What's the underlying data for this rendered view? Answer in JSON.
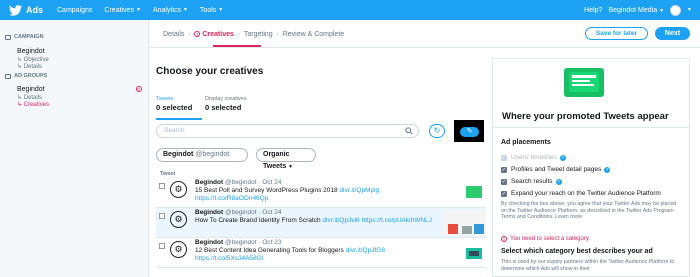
{
  "topbar": {
    "app": "Ads",
    "menus": [
      "Campaigns",
      "Creatives",
      "Analytics",
      "Tools"
    ],
    "help": "Help?",
    "account": "Begindot Media"
  },
  "sidebar": {
    "campaign_header": "CAMPAIGN",
    "campaign_name": "Begindot",
    "campaign_items": [
      "Objective",
      "Details"
    ],
    "adgroups_header": "AD GROUPS",
    "adgroup_name": "Begindot",
    "adgroup_items": [
      "Details",
      "Creatives"
    ]
  },
  "steps": [
    "Details",
    "Creatives",
    "Targeting",
    "Review & Complete"
  ],
  "actions": {
    "save": "Save for later",
    "next": "Next"
  },
  "page_title": "Choose your creatives",
  "tabs": [
    {
      "label": "Tweets",
      "count": "0 selected"
    },
    {
      "label": "Display creatives",
      "count": "0 selected"
    }
  ],
  "search_placeholder": "Search",
  "filters": {
    "account": "Begindot",
    "handle": "@begindot",
    "type": "Organic Tweets"
  },
  "column_header": "Tweet",
  "tweets": [
    {
      "name": "Begindot",
      "handle": "@begindot",
      "date": "Oct 24",
      "text": "15 Best Poll and Survey WordPress Plugins 2018",
      "link1": "dlvr.it/QpMplg",
      "link2": "https://t.co/R8aOOn46Qp"
    },
    {
      "name": "Begindot",
      "handle": "@begindot",
      "date": "Oct 24",
      "text": "How To Create Brand Identity From Scratch",
      "link1": "dlvr.it/QpJvl6",
      "link2": "https://t.co/pUAkihWNLJ"
    },
    {
      "name": "Begindot",
      "handle": "@begindot",
      "date": "Oct 23",
      "text": "12 Best Content Idea Generating Tools for Bloggers",
      "link1": "dlvr.it/QpJfG8",
      "link2": "https://t.co/5Xs34A58GI"
    }
  ],
  "panel": {
    "heading": "Where your promoted Tweets appear",
    "placements_label": "Ad placements",
    "options": [
      "Users' timelines",
      "Profiles and Tweet detail pages",
      "Search results",
      "Expand your reach on the Twitter Audience Platform"
    ],
    "disclaimer": "By checking the box above, you agree that your Twitter Ads may be placed on the Twitter Audience Platform, as described in the Twitter Ads Program Terms and Conditions. Learn more",
    "alert": "You need to select a category.",
    "category_heading": "Select which category best describes your ad",
    "category_text": "This is used by our supply partners within the Twitter Audience Platform to determine which Ads will show in their"
  },
  "colors": {
    "brand": "#1da1f2",
    "error": "#e0245e"
  }
}
